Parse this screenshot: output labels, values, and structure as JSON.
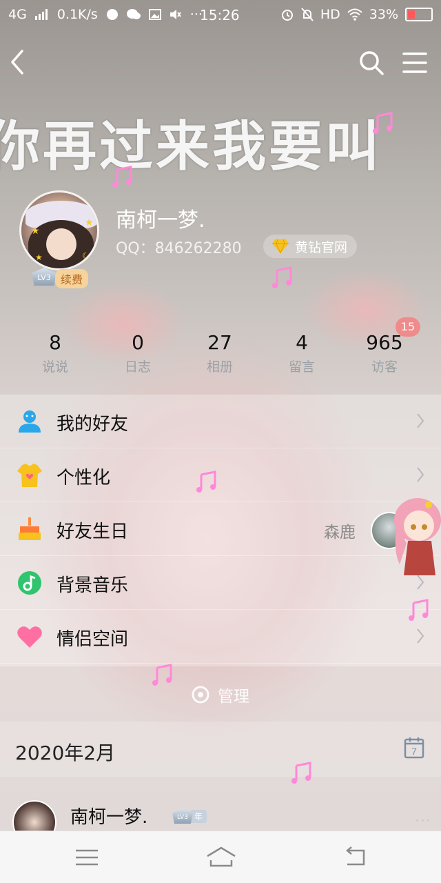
{
  "status_bar": {
    "network": "4G",
    "speed": "0.1K/s",
    "time": "15:26",
    "hd": "HD",
    "battery": "33%",
    "battery_level": 0.33
  },
  "header": {
    "banner_text": "你再过来我要叫"
  },
  "profile": {
    "nickname": "南柯一梦.",
    "qq": "QQ：846262280",
    "level_badge": "LV3",
    "renew_label": "续费",
    "vip_link": "黄钻官网"
  },
  "stats": [
    {
      "value": "8",
      "label": "说说"
    },
    {
      "value": "0",
      "label": "日志"
    },
    {
      "value": "27",
      "label": "相册"
    },
    {
      "value": "4",
      "label": "留言"
    },
    {
      "value": "965",
      "label": "访客"
    }
  ],
  "visitor_badge": "15",
  "menu": [
    {
      "label": "我的好友",
      "icon": "friends-icon"
    },
    {
      "label": "个性化",
      "icon": "personalize-icon"
    },
    {
      "label": "好友生日",
      "icon": "birthday-cake-icon",
      "extra": "森鹿"
    },
    {
      "label": "背景音乐",
      "icon": "music-icon"
    },
    {
      "label": "情侣空间",
      "icon": "heart-icon"
    }
  ],
  "manage_label": "管理",
  "feed": {
    "date": "2020年2月",
    "calendar_day": "7",
    "author": "南柯一梦.",
    "level": "LV3",
    "year_tag": "年",
    "more": "···"
  },
  "colors": {
    "accent_gold": "#f5d39a",
    "badge_red": "#ef8b8b",
    "friends_blue": "#29a7ea",
    "personalize_yellow": "#f7c21e",
    "music_green": "#2fc46d",
    "heart_pink": "#ff6fa1",
    "note_pink": "#ff88d8"
  }
}
